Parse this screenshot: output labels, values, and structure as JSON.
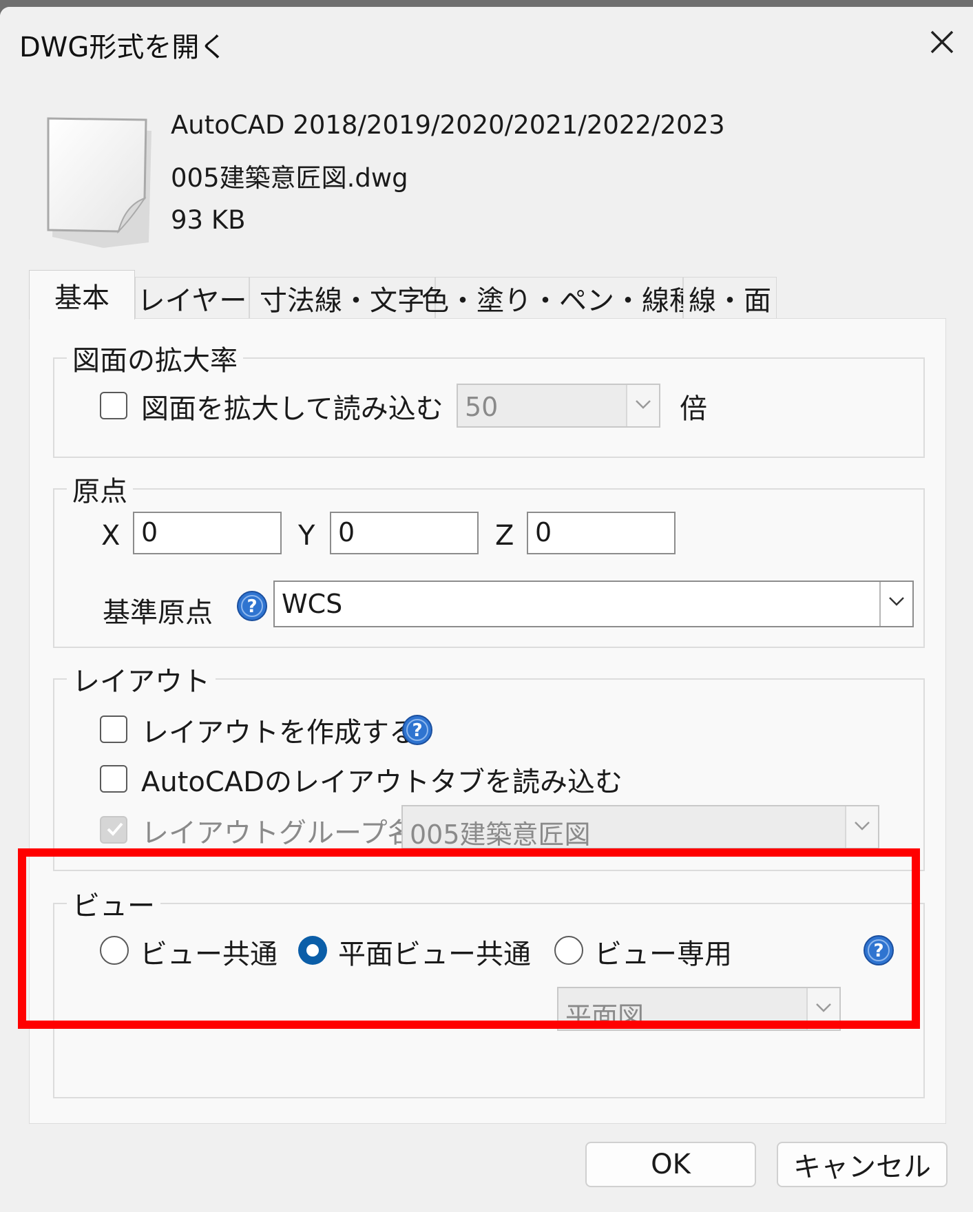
{
  "window": {
    "title": "DWG形式を開く"
  },
  "file": {
    "format": "AutoCAD 2018/2019/2020/2021/2022/2023",
    "name": "005建築意匠図.dwg",
    "size": "93 KB"
  },
  "tabs": [
    {
      "label": "基本",
      "active": true
    },
    {
      "label": "レイヤー"
    },
    {
      "label": "寸法線・文字"
    },
    {
      "label": "色・塗り・ペン・線種"
    },
    {
      "label": "線・面"
    }
  ],
  "scale_group": {
    "title": "図面の拡大率",
    "checkbox_label": "図面を拡大して読み込む",
    "checked": false,
    "value": "50",
    "unit": "倍"
  },
  "origin_group": {
    "title": "原点",
    "x_label": "X",
    "x_value": "0",
    "y_label": "Y",
    "y_value": "0",
    "z_label": "Z",
    "z_value": "0",
    "base_label": "基準原点",
    "base_value": "WCS"
  },
  "layout_group": {
    "title": "レイアウト",
    "create_label": "レイアウトを作成する",
    "import_label": "AutoCADのレイアウトタブを読み込む",
    "group_name_label": "レイアウトグループ名",
    "group_name_value": "005建築意匠図"
  },
  "view_group": {
    "title": "ビュー",
    "options": [
      "ビュー共通",
      "平面ビュー共通",
      "ビュー専用"
    ],
    "selected": "平面ビュー共通",
    "view_select": "平面図"
  },
  "buttons": {
    "ok": "OK",
    "cancel": "キャンセル"
  },
  "colors": {
    "accent": "#0b5ea8",
    "highlight": "#ff0000",
    "help": "#2f74d0"
  },
  "icons": [
    "close-icon",
    "file-icon",
    "help-icon",
    "chevron-down-icon",
    "checkmark-icon"
  ]
}
